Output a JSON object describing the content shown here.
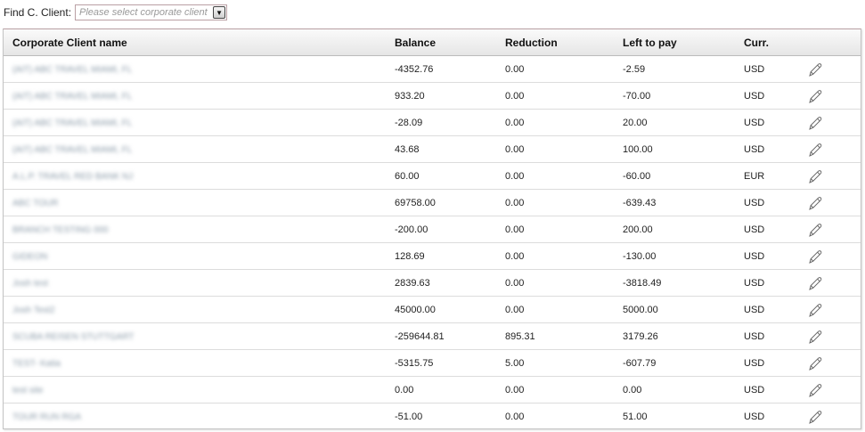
{
  "find": {
    "label": "Find C. Client:",
    "placeholder": "Please select corporate client",
    "dropdown_icon": "triangle-down-icon"
  },
  "table": {
    "headers": {
      "name": "Corporate Client name",
      "balance": "Balance",
      "reduction": "Reduction",
      "left_to_pay": "Left to pay",
      "currency": "Curr."
    },
    "rows": [
      {
        "name": "(AIT) ABC TRAVEL MIAMI, FL",
        "balance": "-4352.76",
        "reduction": "0.00",
        "left_to_pay": "-2.59",
        "currency": "USD"
      },
      {
        "name": "(AIT) ABC TRAVEL MIAMI, FL",
        "balance": "933.20",
        "reduction": "0.00",
        "left_to_pay": "-70.00",
        "currency": "USD"
      },
      {
        "name": "(AIT) ABC TRAVEL MIAMI, FL",
        "balance": "-28.09",
        "reduction": "0.00",
        "left_to_pay": "20.00",
        "currency": "USD"
      },
      {
        "name": "(AIT) ABC TRAVEL MIAMI, FL",
        "balance": "43.68",
        "reduction": "0.00",
        "left_to_pay": "100.00",
        "currency": "USD"
      },
      {
        "name": "A.L.P. TRAVEL RED BANK NJ",
        "balance": "60.00",
        "reduction": "0.00",
        "left_to_pay": "-60.00",
        "currency": "EUR"
      },
      {
        "name": "ABC TOUR",
        "balance": "69758.00",
        "reduction": "0.00",
        "left_to_pay": "-639.43",
        "currency": "USD"
      },
      {
        "name": "BRANCH TESTING 000",
        "balance": "-200.00",
        "reduction": "0.00",
        "left_to_pay": "200.00",
        "currency": "USD"
      },
      {
        "name": "GIDEON",
        "balance": "128.69",
        "reduction": "0.00",
        "left_to_pay": "-130.00",
        "currency": "USD"
      },
      {
        "name": "Josh test",
        "balance": "2839.63",
        "reduction": "0.00",
        "left_to_pay": "-3818.49",
        "currency": "USD"
      },
      {
        "name": "Josh Test2",
        "balance": "45000.00",
        "reduction": "0.00",
        "left_to_pay": "5000.00",
        "currency": "USD"
      },
      {
        "name": "SCUBA REISEN STUTTGART",
        "balance": "-259644.81",
        "reduction": "895.31",
        "left_to_pay": "3179.26",
        "currency": "USD"
      },
      {
        "name": "TEST- Katia",
        "balance": "-5315.75",
        "reduction": "5.00",
        "left_to_pay": "-607.79",
        "currency": "USD"
      },
      {
        "name": "test site",
        "balance": "0.00",
        "reduction": "0.00",
        "left_to_pay": "0.00",
        "currency": "USD"
      },
      {
        "name": "TOUR RUN RGA",
        "balance": "-51.00",
        "reduction": "0.00",
        "left_to_pay": "51.00",
        "currency": "USD"
      }
    ],
    "row_action_icon": "pencil-icon"
  }
}
